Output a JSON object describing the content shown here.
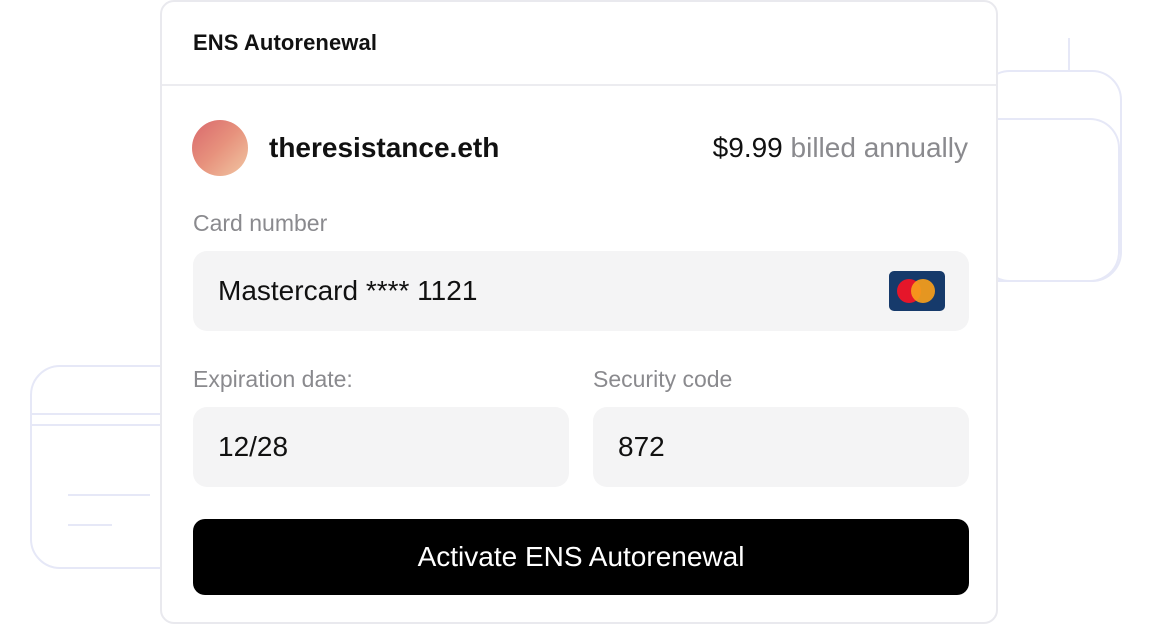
{
  "panel": {
    "title": "ENS Autorenewal"
  },
  "domain": {
    "name": "theresistance.eth",
    "price": "$9.99",
    "billing": "billed annually"
  },
  "form": {
    "card_label": "Card number",
    "card_value": "Mastercard **** 1121",
    "card_brand_icon": "mastercard-icon",
    "expiration_label": "Expiration date:",
    "expiration_value": "12/28",
    "security_label": "Security code",
    "security_value": "872"
  },
  "actions": {
    "activate_label": "Activate ENS Autorenewal"
  },
  "colors": {
    "button_bg": "#000000",
    "field_bg": "#f4f4f5",
    "muted_text": "#8a8a8e",
    "mastercard_red": "#e5162a",
    "mastercard_orange": "#f79e1b",
    "card_logo_bg": "#163a6b"
  }
}
